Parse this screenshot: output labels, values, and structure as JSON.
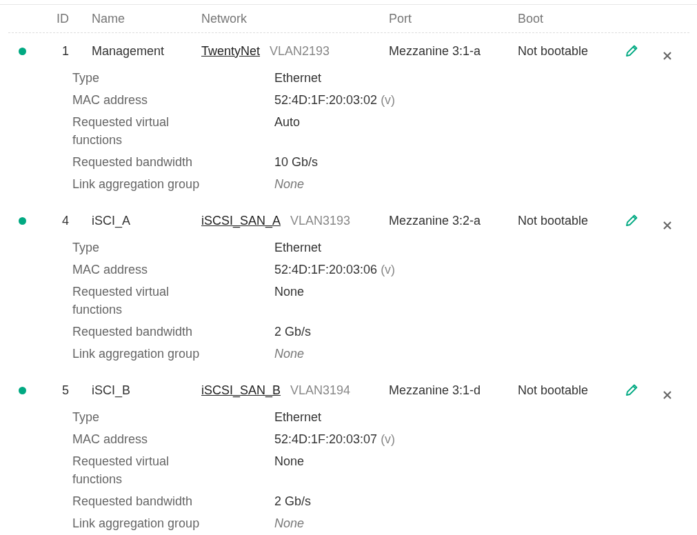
{
  "columns": [
    "ID",
    "Name",
    "Network",
    "Port",
    "Boot"
  ],
  "connections": [
    {
      "id": "1",
      "name": "Management",
      "network": "TwentyNet",
      "vlan": "VLAN2193",
      "port": "Mezzanine 3:1-a",
      "boot": "Not bootable",
      "details": [
        {
          "kind": "text",
          "label": "Type",
          "value": "Ethernet"
        },
        {
          "kind": "mac",
          "label": "MAC address",
          "value": "52:4D:1F:20:03:02",
          "suffix": "(v)"
        },
        {
          "kind": "text",
          "label": "Requested virtual functions",
          "value": "Auto"
        },
        {
          "kind": "text",
          "label": "Requested bandwidth",
          "value": "10 Gb/s"
        },
        {
          "kind": "none",
          "label": "Link aggregation group",
          "value": "None"
        }
      ]
    },
    {
      "id": "4",
      "name": "iSCI_A",
      "network": "iSCSI_SAN_A",
      "vlan": "VLAN3193",
      "port": "Mezzanine 3:2-a",
      "boot": "Not bootable",
      "details": [
        {
          "kind": "text",
          "label": "Type",
          "value": "Ethernet"
        },
        {
          "kind": "mac",
          "label": "MAC address",
          "value": "52:4D:1F:20:03:06",
          "suffix": "(v)"
        },
        {
          "kind": "text",
          "label": "Requested virtual functions",
          "value": "None"
        },
        {
          "kind": "text",
          "label": "Requested bandwidth",
          "value": "2 Gb/s"
        },
        {
          "kind": "none",
          "label": "Link aggregation group",
          "value": "None"
        }
      ]
    },
    {
      "id": "5",
      "name": "iSCI_B",
      "network": "iSCSI_SAN_B",
      "vlan": "VLAN3194",
      "port": "Mezzanine 3:1-d",
      "boot": "Not bootable",
      "details": [
        {
          "kind": "text",
          "label": "Type",
          "value": "Ethernet"
        },
        {
          "kind": "mac",
          "label": "MAC address",
          "value": "52:4D:1F:20:03:07",
          "suffix": "(v)"
        },
        {
          "kind": "text",
          "label": "Requested virtual functions",
          "value": "None"
        },
        {
          "kind": "text",
          "label": "Requested bandwidth",
          "value": "2 Gb/s"
        },
        {
          "kind": "none",
          "label": "Link aggregation group",
          "value": "None"
        }
      ]
    }
  ]
}
